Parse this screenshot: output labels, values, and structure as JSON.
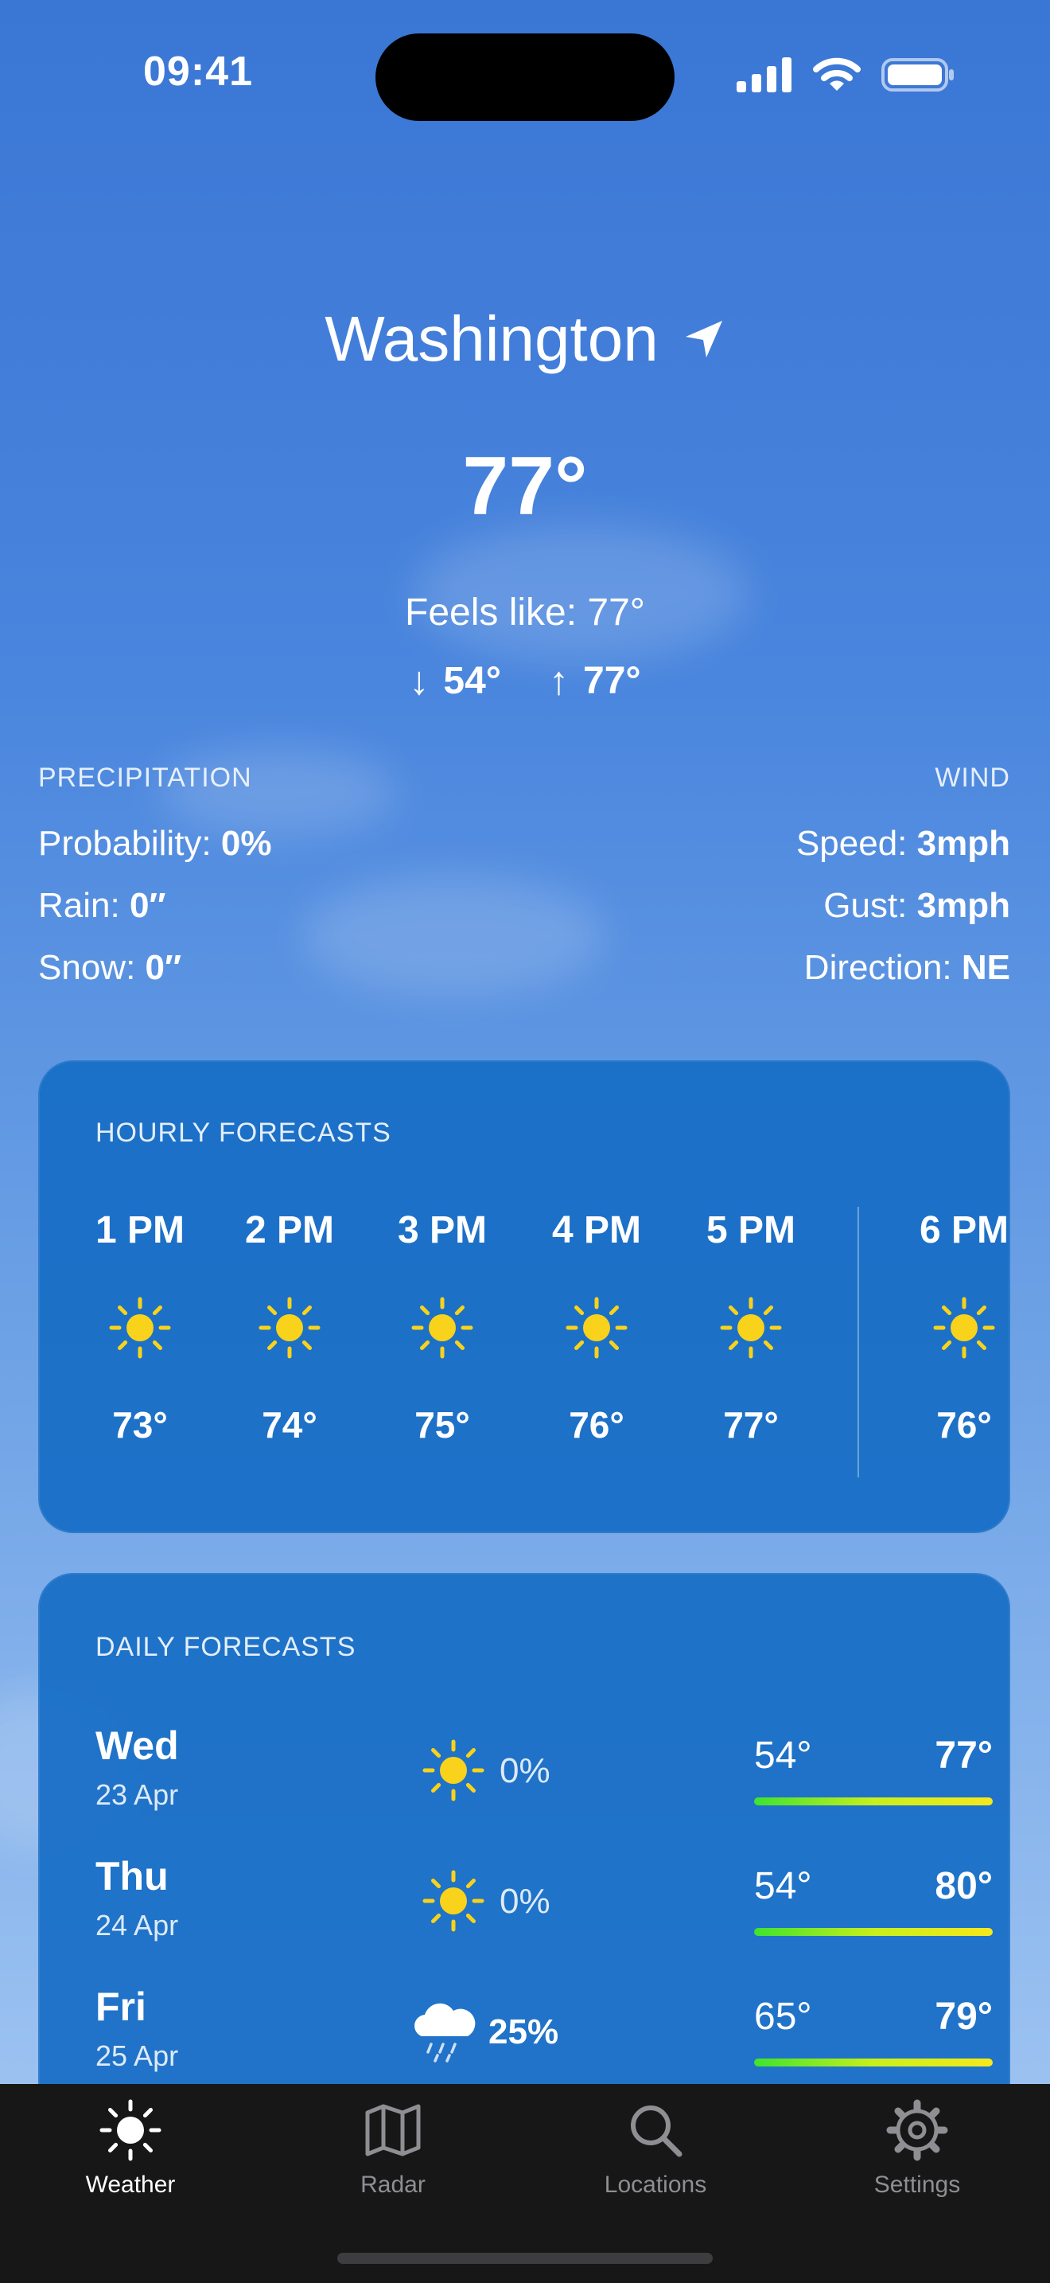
{
  "status_bar": {
    "time": "09:41"
  },
  "location": {
    "city": "Washington"
  },
  "current": {
    "temperature": "77°",
    "feels_like": "Feels like: 77°",
    "low": "54°",
    "high": "77°"
  },
  "precipitation": {
    "heading": "PRECIPITATION",
    "rows": [
      {
        "label": "Probability: ",
        "value": "0%"
      },
      {
        "label": "Rain: ",
        "value": "0″"
      },
      {
        "label": "Snow: ",
        "value": "0″"
      }
    ]
  },
  "wind": {
    "heading": "WIND",
    "rows": [
      {
        "label": "Speed: ",
        "value": "3mph"
      },
      {
        "label": "Gust: ",
        "value": "3mph"
      },
      {
        "label": "Direction: ",
        "value": "NE"
      }
    ]
  },
  "hourly": {
    "title": "HOURLY FORECASTS",
    "items": [
      {
        "time": "1 PM",
        "icon": "sun-icon",
        "temp": "73°"
      },
      {
        "time": "2 PM",
        "icon": "sun-icon",
        "temp": "74°"
      },
      {
        "time": "3 PM",
        "icon": "sun-icon",
        "temp": "75°"
      },
      {
        "time": "4 PM",
        "icon": "sun-icon",
        "temp": "76°"
      },
      {
        "time": "5 PM",
        "icon": "sun-icon",
        "temp": "77°"
      },
      {
        "time": "6 PM",
        "icon": "sun-icon",
        "temp": "76°"
      }
    ]
  },
  "daily": {
    "title": "DAILY FORECASTS",
    "items": [
      {
        "day": "Wed",
        "date": "23 Apr",
        "icon": "sun-icon",
        "pop": "0%",
        "low": "54°",
        "high": "77°"
      },
      {
        "day": "Thu",
        "date": "24 Apr",
        "icon": "sun-icon",
        "pop": "0%",
        "low": "54°",
        "high": "80°"
      },
      {
        "day": "Fri",
        "date": "25 Apr",
        "icon": "cloud-rain-icon",
        "pop": "25%",
        "low": "65°",
        "high": "79°"
      }
    ]
  },
  "tabs": [
    {
      "label": "Weather",
      "icon": "sun-icon",
      "active": true
    },
    {
      "label": "Radar",
      "icon": "map-icon",
      "active": false
    },
    {
      "label": "Locations",
      "icon": "search-icon",
      "active": false
    },
    {
      "label": "Settings",
      "icon": "gear-icon",
      "active": false
    }
  ],
  "colors": {
    "sun": "#f8d21b",
    "card": "#166cc4",
    "tabbar": "#171717"
  }
}
